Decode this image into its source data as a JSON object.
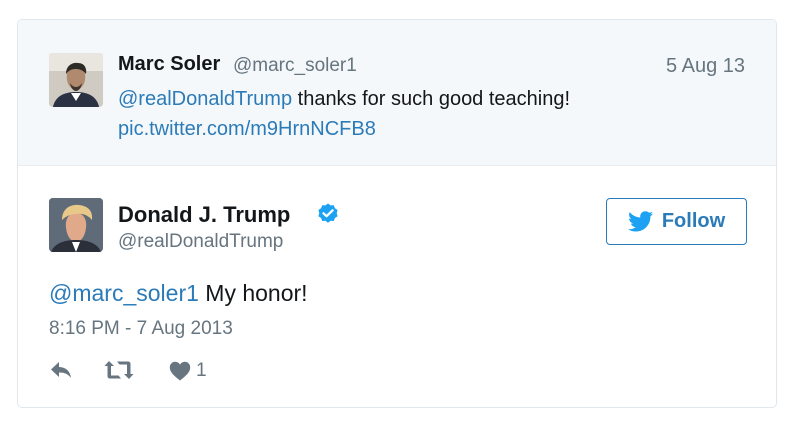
{
  "parent_tweet": {
    "author_name": "Marc Soler",
    "author_handle": "@marc_soler1",
    "date": "5 Aug 13",
    "mention": "@realDonaldTrump",
    "text": " thanks for such good teaching!",
    "link": "pic.twitter.com/m9HrnNCFB8",
    "avatar": "avatar-photo"
  },
  "main_tweet": {
    "author_name": "Donald J. Trump",
    "author_handle": "@realDonaldTrump",
    "verified_icon": "verified-badge-icon",
    "follow_label": "Follow",
    "mention": "@marc_soler1",
    "text": " My honor!",
    "timestamp": "8:16 PM - 7 Aug 2013",
    "like_count": "1",
    "avatar": "avatar-photo"
  },
  "colors": {
    "link": "#2b7bb9",
    "secondary_text": "#66757f",
    "parent_background": "#f5f8fa",
    "border": "#e1e8ed",
    "verified": "#1da1f2"
  },
  "icons": [
    "reply-icon",
    "retweet-icon",
    "like-icon",
    "twitter-bird-icon",
    "verified-badge-icon"
  ]
}
